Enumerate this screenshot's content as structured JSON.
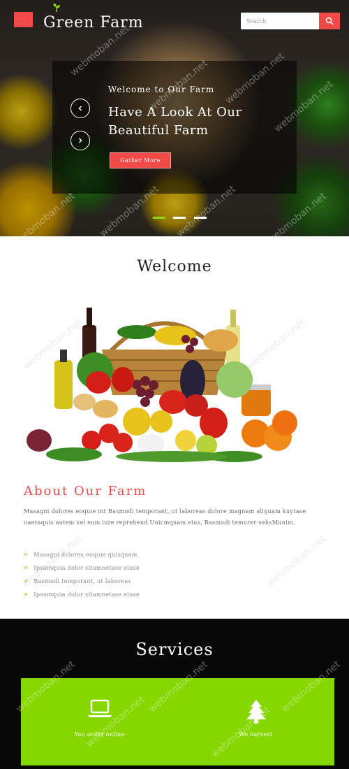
{
  "header": {
    "brand": "Green Farm",
    "search_placeholder": "Search"
  },
  "hero": {
    "subtitle": "Welcome to Our Farm",
    "title": "Have A Look At Our Beautiful Farm",
    "cta_label": "Gather More",
    "slide_count": 3,
    "active_slide": 1
  },
  "welcome": {
    "title": "Welcome"
  },
  "about": {
    "title": "About Our Farm",
    "text": "Masagni dolores eoquie int Basmodi temporant, ut laboreas dolore magnam aliquam kuytase uaeraquis autem vel eum iure reprehend.Unicmquam eius, Basmodi temurer sehsMunim.",
    "items": [
      "Masagni dolores eoquie quisquam",
      "Ipsumquia dolor sitamnetase eiuse",
      "Basmodi temporant, ut laboreas",
      "Ipsumquia dolor sitamnetase eiuse"
    ]
  },
  "services": {
    "title": "Services",
    "items": [
      {
        "label": "You order online",
        "icon": "laptop-icon"
      },
      {
        "label": "We harvest",
        "icon": "tree-icon"
      }
    ]
  },
  "watermark": "webmoban.net",
  "colors": {
    "accent_red": "#ef4a48",
    "accent_green": "#86d600",
    "dark": "#080808"
  }
}
